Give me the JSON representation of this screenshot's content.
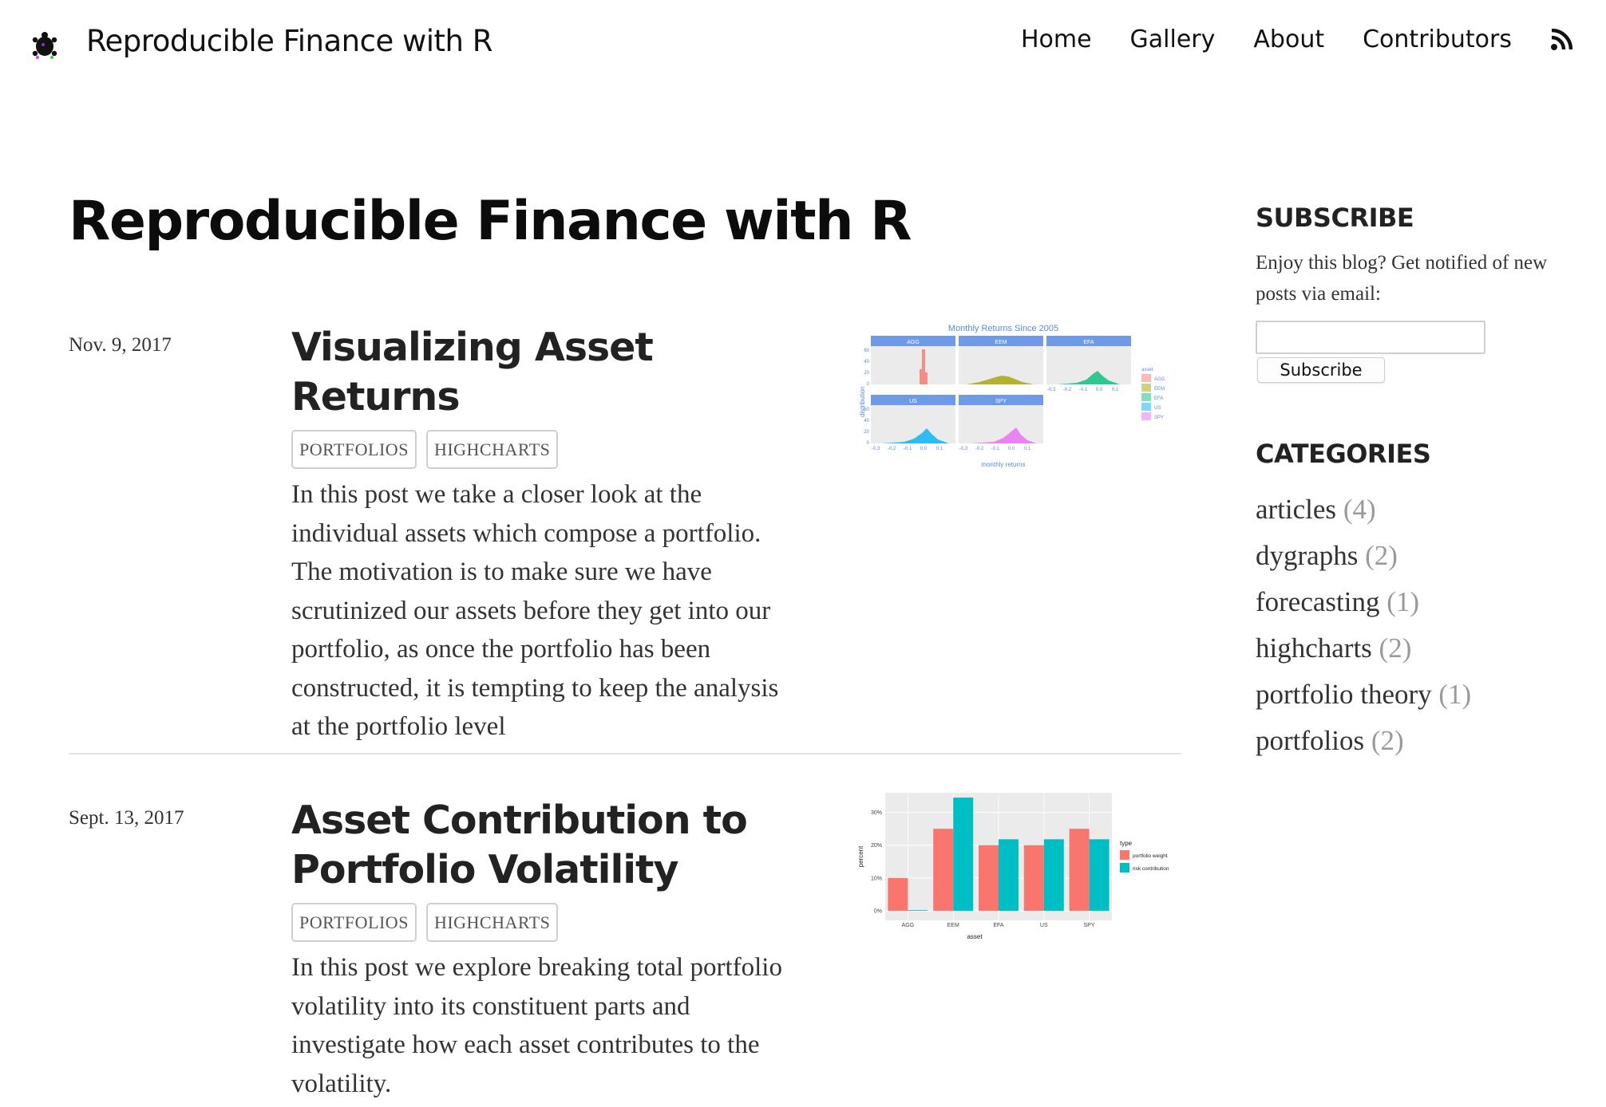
{
  "header": {
    "site_title": "Reproducible Finance with R",
    "nav": [
      "Home",
      "Gallery",
      "About",
      "Contributors"
    ]
  },
  "main": {
    "page_title": "Reproducible Finance with R",
    "posts": [
      {
        "date": "Nov. 9, 2017",
        "title": "Visualizing Asset Returns",
        "tags": [
          "PORTFOLIOS",
          "HIGHCHARTS"
        ],
        "excerpt": "In this post we take a closer look at the individual assets which compose a portfolio. The motivation is to make sure we have scrutinized our assets before they get into our portfolio, as once the portfolio has been constructed, it is tempting to keep the analysis at the portfolio level",
        "thumbnail": {
          "title": "Monthly Returns Since 2005",
          "panels": [
            "AGG",
            "EEM",
            "EFA",
            "US",
            "SPY"
          ],
          "ylabel": "distribution",
          "xlabel": "monthly returns",
          "yticks": [
            "60",
            "40",
            "20",
            "0"
          ],
          "xticks": [
            "-0.3",
            "-0.2",
            "-0.1",
            "0.0",
            "0.1"
          ],
          "legend_title": "asset",
          "legend": [
            "AGG",
            "EEM",
            "EFA",
            "US",
            "SPY"
          ],
          "colors": [
            "#F8766D",
            "#A3A500",
            "#00BF7D",
            "#00B0F6",
            "#E76BF3"
          ]
        }
      },
      {
        "date": "Sept. 13, 2017",
        "title": "Asset Contribution to Portfolio Volatility",
        "tags": [
          "PORTFOLIOS",
          "HIGHCHARTS"
        ],
        "excerpt": "In this post we explore breaking total portfolio volatility into its constituent parts and investigate how each asset contributes to the volatility."
      }
    ]
  },
  "sidebar": {
    "subscribe_heading": "SUBSCRIBE",
    "subscribe_text": "Enjoy this blog? Get notified of new posts via email:",
    "email_placeholder": "",
    "subscribe_button": "Subscribe",
    "categories_heading": "CATEGORIES",
    "categories": [
      {
        "name": "articles",
        "count": "(4)"
      },
      {
        "name": "dygraphs",
        "count": "(2)"
      },
      {
        "name": "forecasting",
        "count": "(1)"
      },
      {
        "name": "highcharts",
        "count": "(2)"
      },
      {
        "name": "portfolio theory",
        "count": "(1)"
      },
      {
        "name": "portfolios",
        "count": "(2)"
      }
    ]
  },
  "chart_data": {
    "type": "bar",
    "categories": [
      "AGG",
      "EEM",
      "EFA",
      "US",
      "SPY"
    ],
    "series": [
      {
        "name": "portfolio weight",
        "values": [
          10,
          25,
          20,
          20,
          25
        ],
        "color": "#F8766D"
      },
      {
        "name": "risk contribution",
        "values": [
          0.2,
          34.5,
          21.8,
          21.8,
          21.8
        ],
        "color": "#00BFC4"
      }
    ],
    "xlabel": "asset",
    "ylabel": "percent",
    "ylim": [
      0,
      35
    ],
    "yticks": [
      "0%",
      "10%",
      "20%",
      "30%"
    ],
    "legend_title": "type",
    "legend_position": "right",
    "grid": true
  }
}
